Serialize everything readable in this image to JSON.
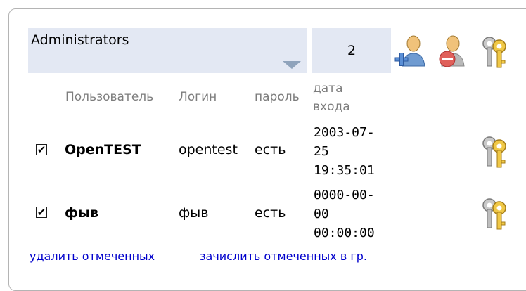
{
  "group": {
    "selected": "Administrators",
    "member_count": "2"
  },
  "toolbar": {
    "icons": [
      "add-user-icon",
      "remove-user-icon",
      "keys-icon"
    ]
  },
  "table": {
    "headers": {
      "user": "Пользователь",
      "login": "Логин",
      "password": "пароль",
      "date_line1": "дата",
      "date_line2": "входа"
    },
    "rows": [
      {
        "checked": true,
        "user": "OpenTEST",
        "login": "opentest",
        "password": "есть",
        "date": [
          "2003-07-",
          "25",
          "19:35:01"
        ]
      },
      {
        "checked": true,
        "user": "фыв",
        "login": "фыв",
        "password": "есть",
        "date": [
          "0000-00-",
          "00",
          "00:00:00"
        ]
      }
    ]
  },
  "actions": {
    "delete_checked": "удалить отмеченных",
    "enroll_checked": "зачислить отмеченных в гр."
  }
}
